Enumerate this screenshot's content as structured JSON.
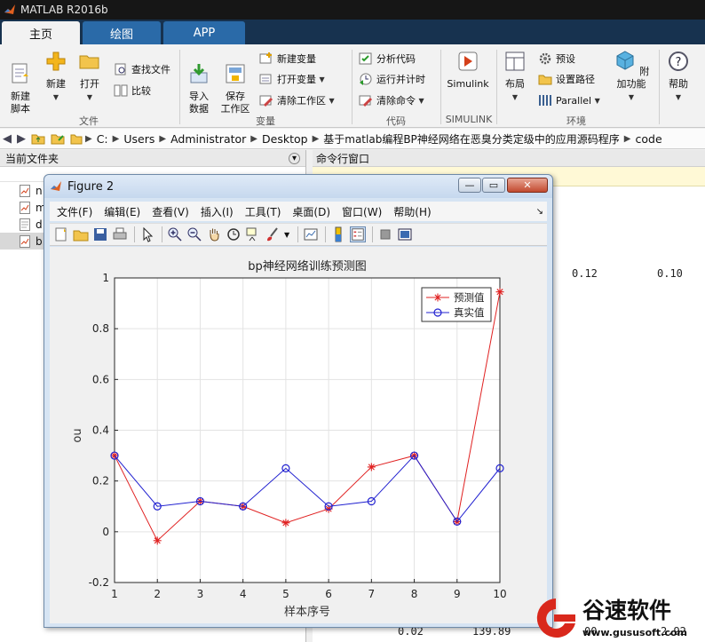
{
  "app": {
    "title": "MATLAB R2016b"
  },
  "tabs": [
    {
      "label": "主页",
      "active": true
    },
    {
      "label": "绘图",
      "active": false
    },
    {
      "label": "APP",
      "active": false
    }
  ],
  "ribbon": {
    "file": {
      "group": "文件",
      "new_script": "新建\n脚本",
      "new": "新建",
      "open": "打开",
      "find_files": "查找文件",
      "compare": "比较"
    },
    "variable": {
      "group": "变量",
      "import_data": "导入\n数据",
      "save_workspace": "保存\n工作区",
      "new_variable": "新建变量",
      "open_variable": "打开变量",
      "clear_workspace": "清除工作区"
    },
    "code": {
      "group": "代码",
      "analyze_code": "分析代码",
      "run_and_time": "运行并计时",
      "clear_commands": "清除命令"
    },
    "simulink": {
      "group": "SIMULINK",
      "label": "Simulink"
    },
    "environment": {
      "group": "环境",
      "layout": "布局",
      "preferences": "预设",
      "set_path": "设置路径",
      "parallel": "Parallel",
      "add_ons": "附加功能"
    },
    "help": {
      "label": "帮助"
    }
  },
  "path": {
    "segments": [
      "C:",
      "Users",
      "Administrator",
      "Desktop",
      "基于matlab编程BP神经网络在恶臭分类定级中的应用源码程序",
      "code"
    ]
  },
  "current_folder": {
    "title": "当前文件夹",
    "items": [
      "n",
      "m",
      "d",
      "b"
    ]
  },
  "command_window": {
    "title": "命令行窗口",
    "values_row1": [
      "0.12",
      "0.10"
    ],
    "values_bottom": [
      "0.02",
      "139.89",
      "00",
      "2.92"
    ]
  },
  "figure": {
    "title": "Figure 2",
    "menu": [
      "文件(F)",
      "编辑(E)",
      "查看(V)",
      "插入(I)",
      "工具(T)",
      "桌面(D)",
      "窗口(W)",
      "帮助(H)"
    ]
  },
  "chart_data": {
    "type": "line",
    "title": "bp神经网络训练预测图",
    "xlabel": "样本序号",
    "ylabel": "ou",
    "x": [
      1,
      2,
      3,
      4,
      5,
      6,
      7,
      8,
      9,
      10
    ],
    "xlim": [
      1,
      10
    ],
    "ylim": [
      -0.2,
      1
    ],
    "xticks": [
      "1",
      "2",
      "3",
      "4",
      "5",
      "6",
      "7",
      "8",
      "9",
      "10"
    ],
    "yticks": [
      "-0.2",
      "0",
      "0.2",
      "0.4",
      "0.6",
      "0.8",
      "1"
    ],
    "grid": true,
    "legend_position": "top-right",
    "series": [
      {
        "name": "预测值",
        "values": [
          0.3,
          -0.035,
          0.12,
          0.1,
          0.035,
          0.09,
          0.255,
          0.3,
          0.04,
          0.945
        ],
        "color": "#e02020",
        "marker": "star"
      },
      {
        "name": "真实值",
        "values": [
          0.3,
          0.1,
          0.12,
          0.1,
          0.25,
          0.1,
          0.12,
          0.3,
          0.04,
          0.25
        ],
        "color": "#2020d0",
        "marker": "circle"
      }
    ]
  },
  "watermark": {
    "brand": "谷速软件",
    "url": "www.gususoft.com"
  }
}
